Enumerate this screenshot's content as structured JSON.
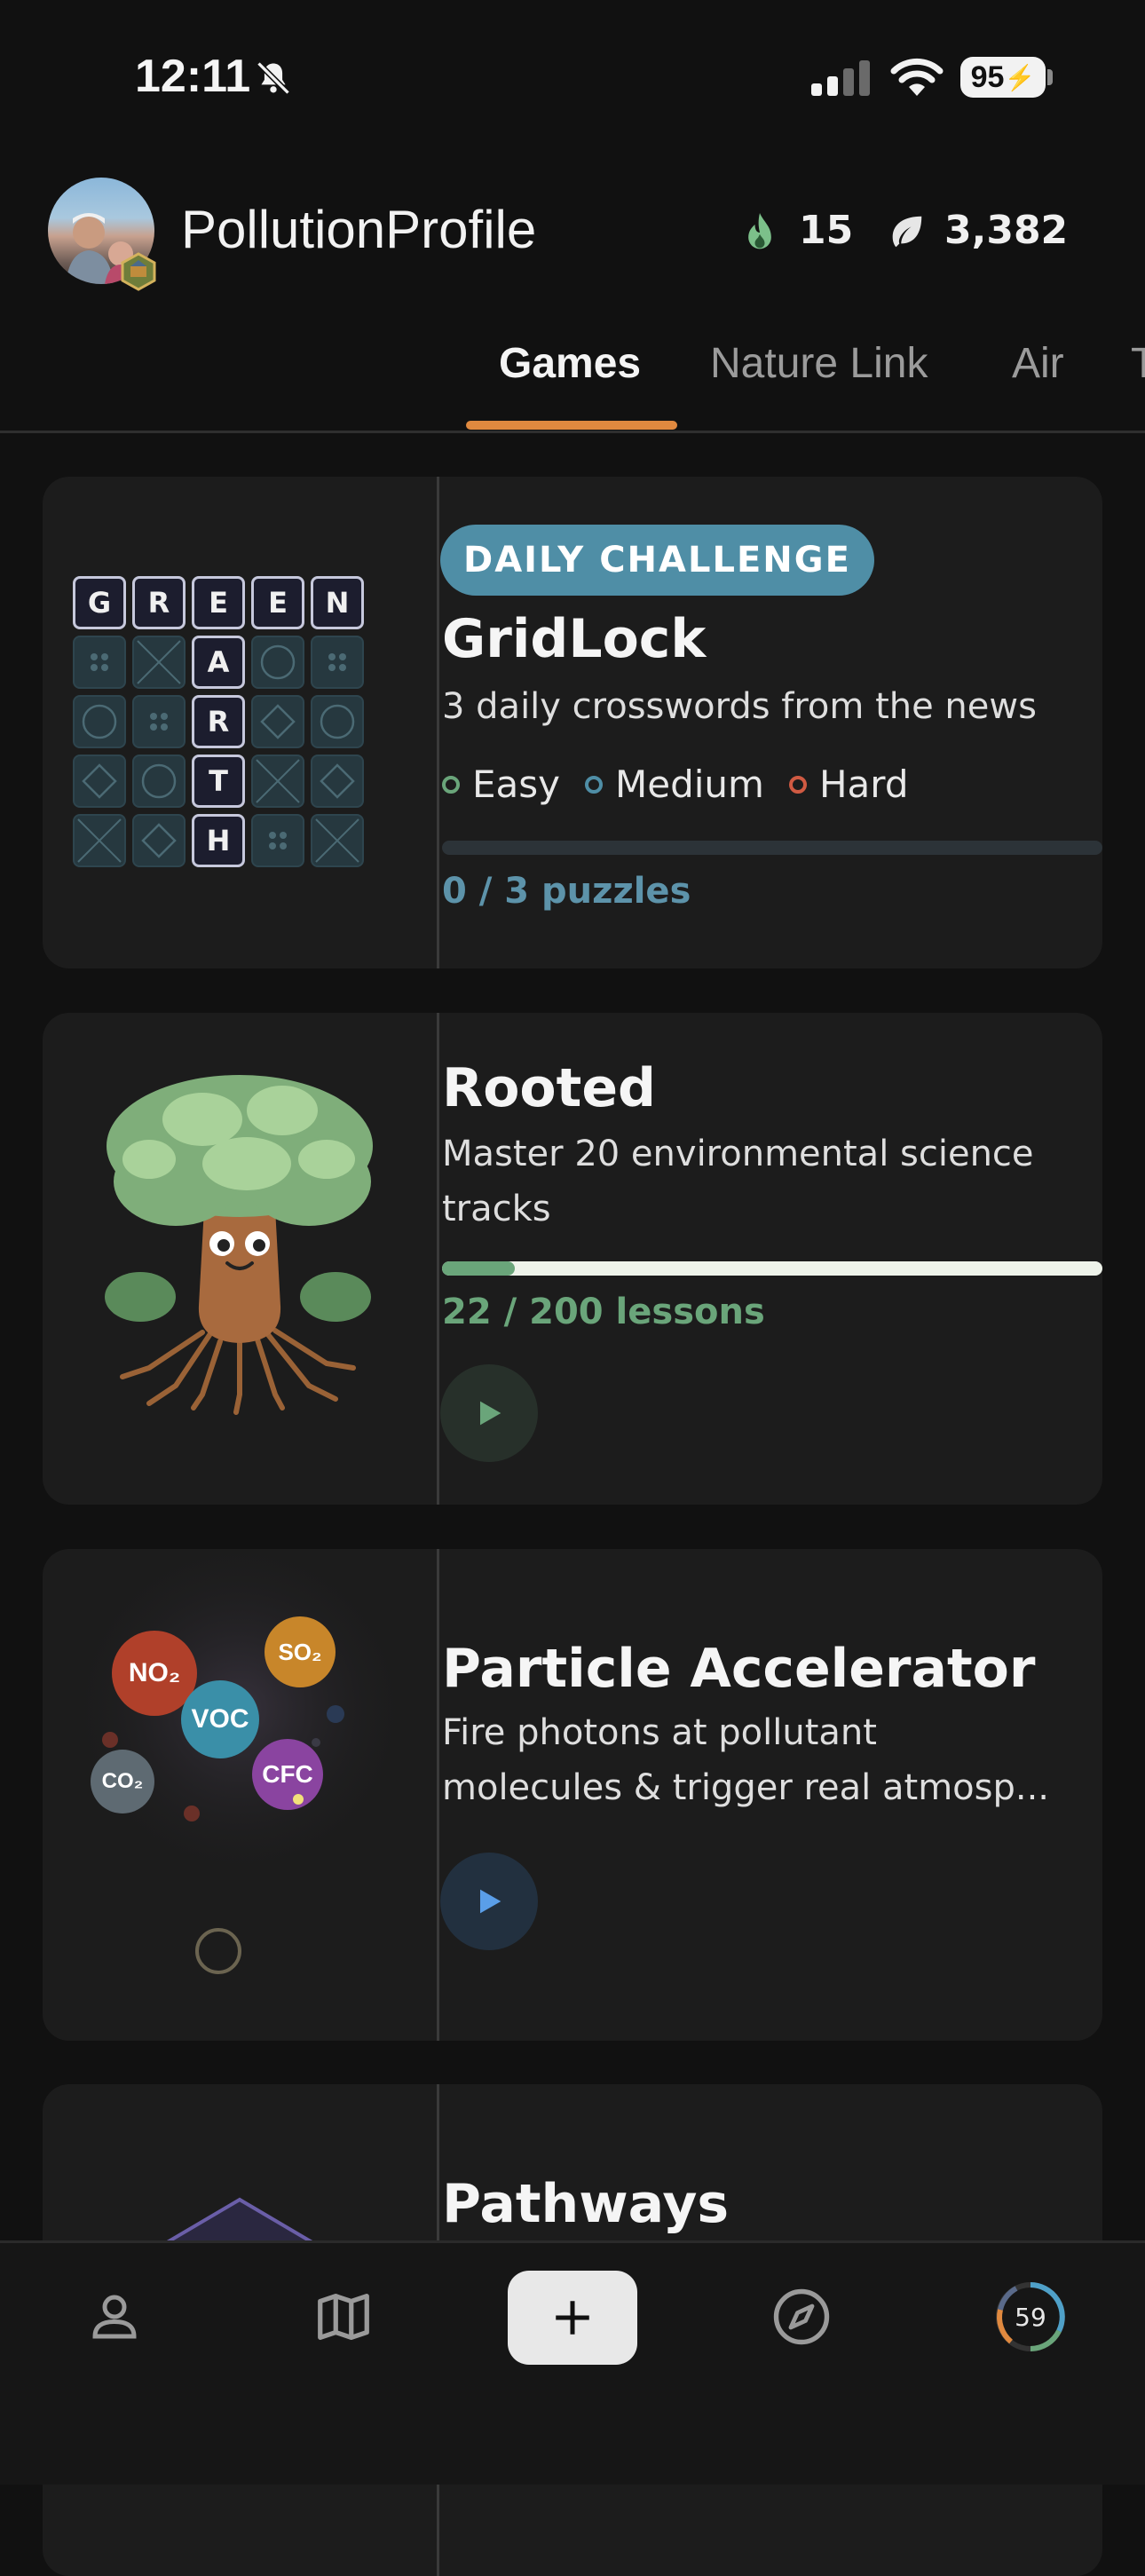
{
  "status_bar": {
    "time": "12:11",
    "battery": "95"
  },
  "header": {
    "username": "PollutionProfile",
    "streak": "15",
    "points": "3,382"
  },
  "tabs": [
    {
      "label": "Games",
      "active": true
    },
    {
      "label": "Nature Link",
      "active": false
    },
    {
      "label": "Air",
      "active": false
    },
    {
      "label": "T",
      "active": false
    }
  ],
  "cards": [
    {
      "badge": "DAILY CHALLENGE",
      "title": "GridLock",
      "description": "3 daily crosswords from the news",
      "difficulties": [
        {
          "label": "Easy",
          "color": "#6aa57a"
        },
        {
          "label": "Medium",
          "color": "#4f8ea6"
        },
        {
          "label": "Hard",
          "color": "#d05a42"
        }
      ],
      "progress": 0,
      "progress_text": "0 / 3 puzzles",
      "grid_letters": {
        "row": [
          "G",
          "R",
          "E",
          "E",
          "N"
        ],
        "column": [
          "A",
          "R",
          "T",
          "H"
        ]
      }
    },
    {
      "title": "Rooted",
      "description": "Master 20 environmental science tracks",
      "progress": 0.11,
      "progress_text": "22 / 200 lessons"
    },
    {
      "title": "Particle Accelerator",
      "description": "Fire photons at pollutant molecules & trigger real atmosp...",
      "molecules": [
        "NO₂",
        "SO₂",
        "VOC",
        "CO₂",
        "CFC"
      ]
    },
    {
      "title": "Pathways"
    }
  ],
  "bottom_nav": {
    "score": "59"
  },
  "colors": {
    "accent": "#e0893f",
    "badge": "#4f8ea6",
    "rooted_green": "#6aa57a",
    "play_blue": "#5a9ee8"
  }
}
